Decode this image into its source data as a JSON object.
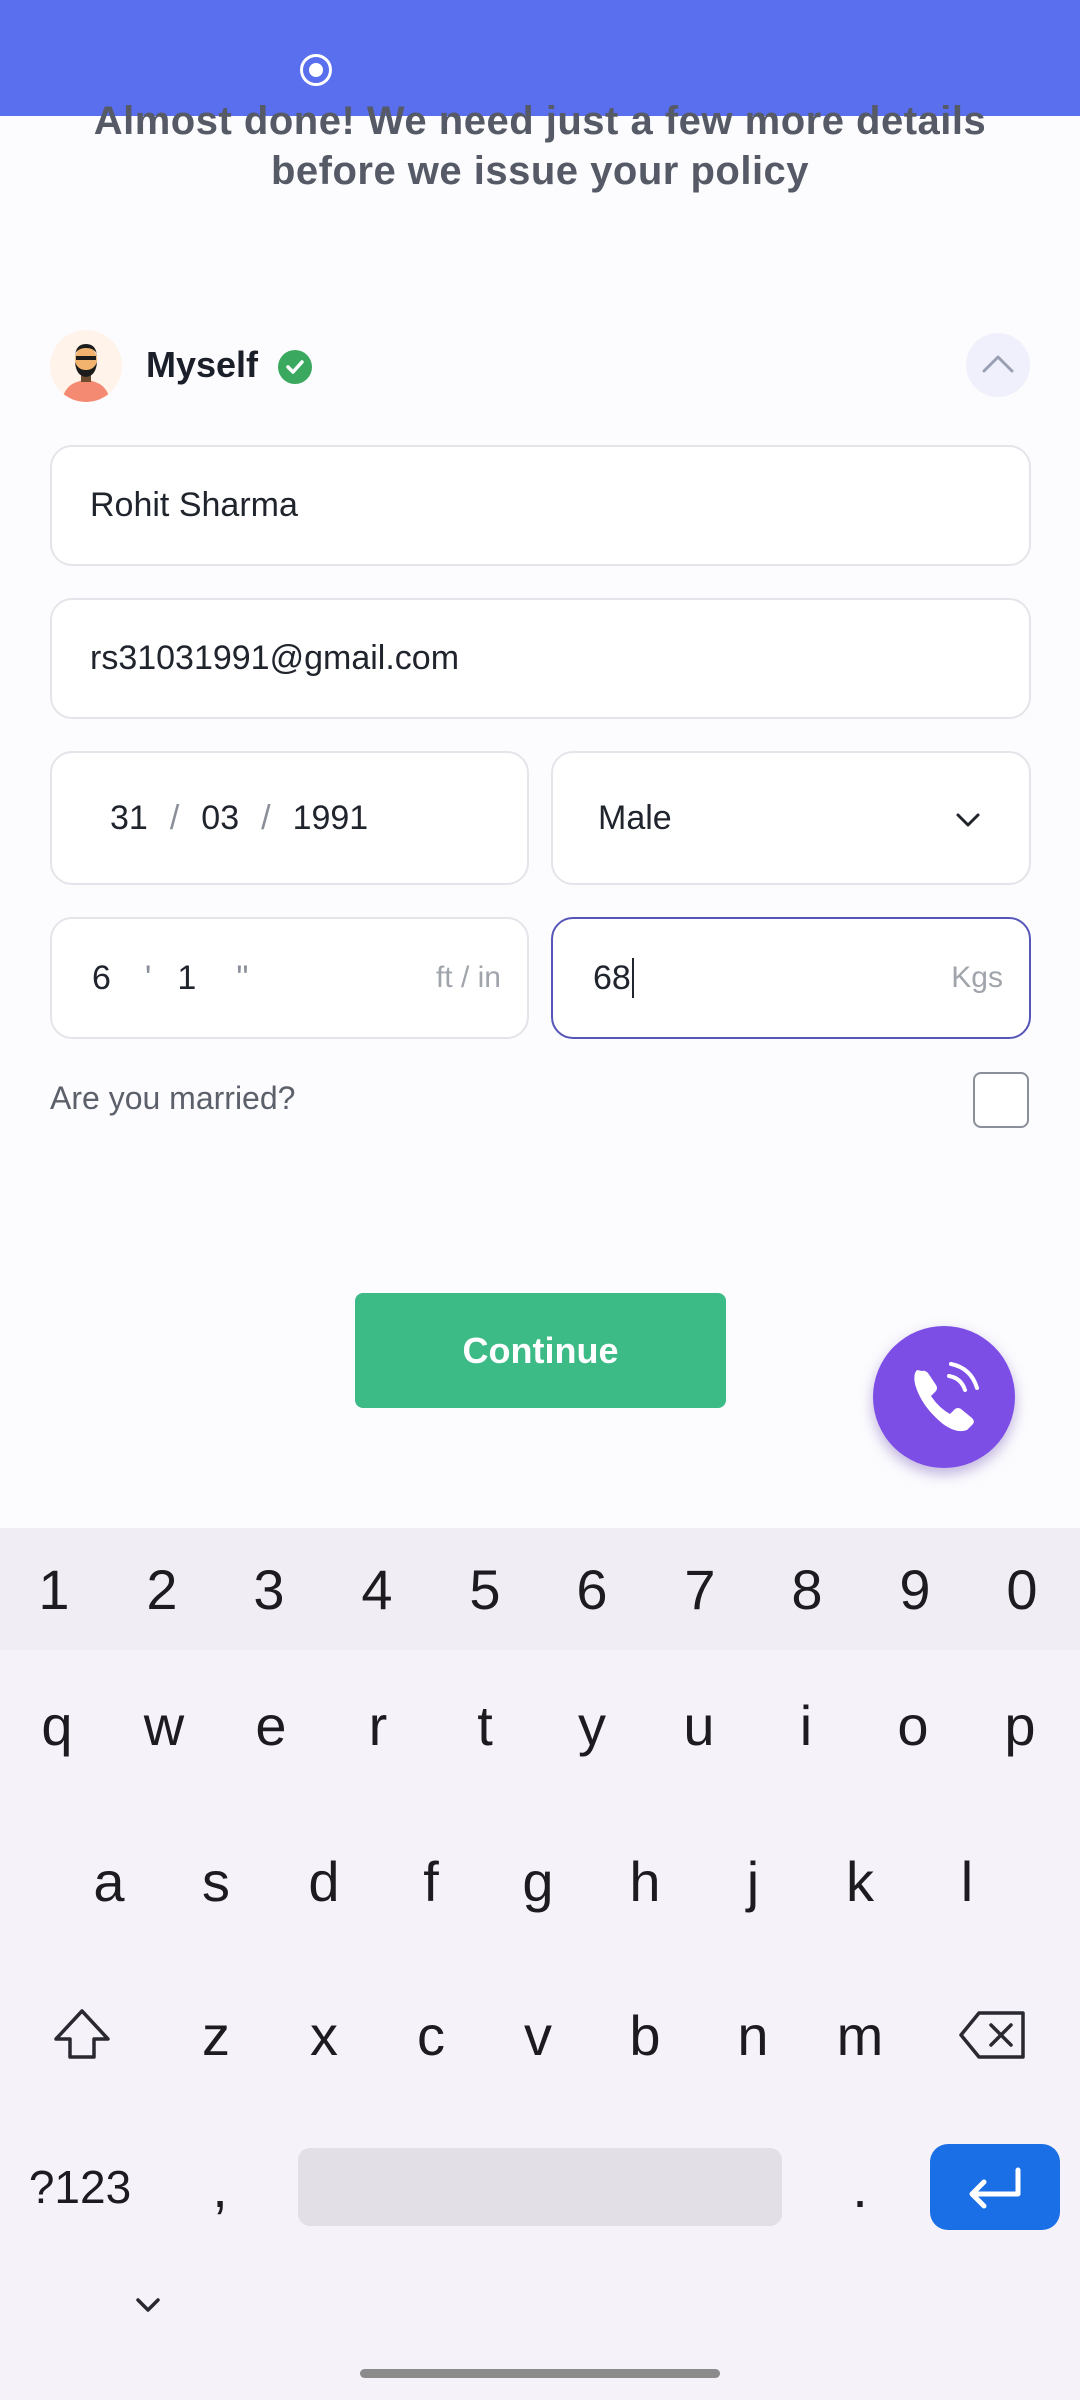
{
  "header": {
    "headline_line1": "Almost done! We need just a few more details",
    "headline_line2": "before we issue your policy"
  },
  "member": {
    "name": "Myself"
  },
  "form": {
    "full_name": "Rohit Sharma",
    "email": "rs31031991@gmail.com",
    "dob": {
      "day": "31",
      "month": "03",
      "year": "1991",
      "separator": "/"
    },
    "gender": "Male",
    "height": {
      "feet": "6",
      "feet_mark": "'",
      "inches": "1",
      "inches_mark": "\"",
      "unit": "ft / in"
    },
    "weight": {
      "value": "68",
      "unit": "Kgs"
    },
    "married_label": "Are you married?",
    "married_checked": false
  },
  "actions": {
    "continue_label": "Continue"
  },
  "keyboard": {
    "number_row": [
      "1",
      "2",
      "3",
      "4",
      "5",
      "6",
      "7",
      "8",
      "9",
      "0"
    ],
    "row1": [
      "q",
      "w",
      "e",
      "r",
      "t",
      "y",
      "u",
      "i",
      "o",
      "p"
    ],
    "row2": [
      "a",
      "s",
      "d",
      "f",
      "g",
      "h",
      "j",
      "k",
      "l"
    ],
    "row3": [
      "z",
      "x",
      "c",
      "v",
      "b",
      "n",
      "m"
    ],
    "symbols_label": "?123",
    "comma": ",",
    "period": "."
  },
  "colors": {
    "status_bar": "#5a6fee",
    "continue": "#3cbb87",
    "call_fab": "#7c4ee6",
    "enter_key": "#1b6fe6",
    "verified": "#3aa85e"
  },
  "icons": [
    "record-icon",
    "avatar",
    "verified-check-icon",
    "chevron-up-icon",
    "chevron-down-icon",
    "phone-call-icon",
    "shift-icon",
    "backspace-icon",
    "enter-icon",
    "keyboard-hide-icon"
  ]
}
